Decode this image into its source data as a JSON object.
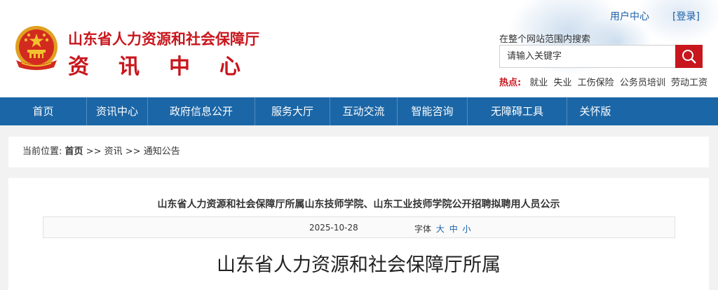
{
  "header": {
    "site_name": "山东省人力资源和社会保障厅",
    "site_sub": "资讯中心",
    "user_center": "用户中心",
    "login": "[登录]",
    "search_hint": "在整个网站范围内搜索",
    "search_placeholder": "请输入关键字",
    "hot_label": "热点:",
    "hot_words": [
      "就业",
      "失业",
      "工伤保险",
      "公务员培训",
      "劳动工资"
    ]
  },
  "nav": {
    "items": [
      "首页",
      "资讯中心",
      "政府信息公开",
      "服务大厅",
      "互动交流",
      "智能咨询",
      "无障碍工具",
      "关怀版"
    ]
  },
  "breadcrumb": {
    "prefix": "当前位置:",
    "home": "首页",
    "sep1": ">>",
    "item1": "资讯",
    "sep2": ">>",
    "item2": "通知公告"
  },
  "article": {
    "title": "山东省人力资源和社会保障厅所属山东技师学院、山东工业技师学院公开招聘拟聘用人员公示",
    "date": "2025-10-28",
    "font_label": "字体",
    "font_large": "大",
    "font_medium": "中",
    "font_small": "小",
    "body_heading": "山东省人力资源和社会保障厅所属"
  },
  "colors": {
    "brand_red": "#c8161d",
    "nav_blue": "#1b66a6",
    "link_blue": "#1b5fa6"
  }
}
